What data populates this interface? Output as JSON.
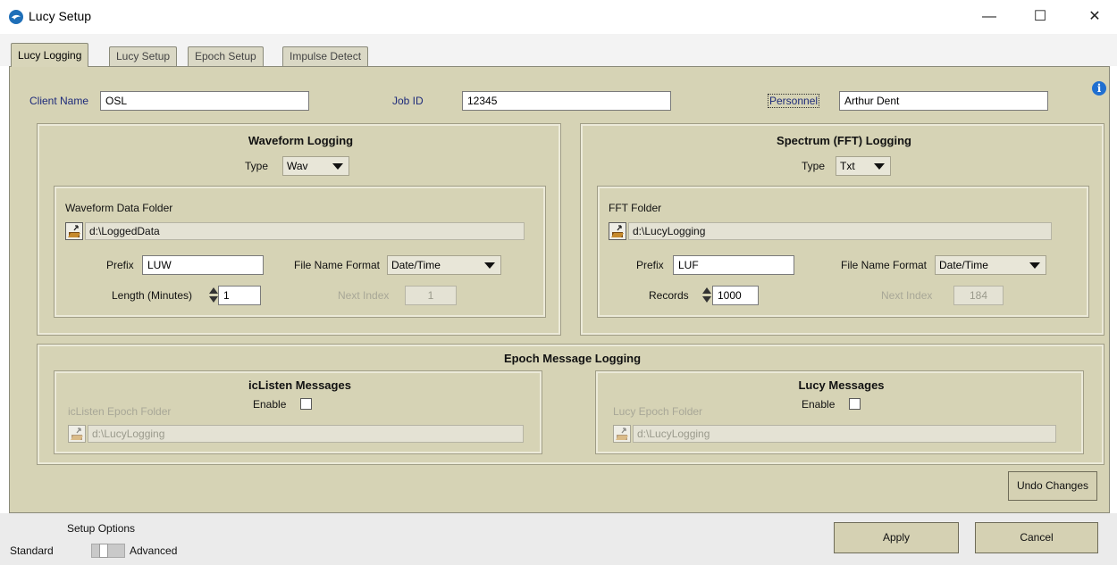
{
  "window": {
    "title": "Lucy Setup",
    "controls": {
      "minimize": "—",
      "maximize": "☐",
      "close": "✕"
    }
  },
  "tabs": [
    {
      "label": "Lucy Logging",
      "active": true
    },
    {
      "label": "Lucy Setup",
      "active": false
    },
    {
      "label": "Epoch Setup",
      "active": false
    },
    {
      "label": "Impulse Detect",
      "active": false
    }
  ],
  "header_fields": {
    "client_name": {
      "label": "Client Name",
      "value": "OSL"
    },
    "job_id": {
      "label": "Job ID",
      "value": "12345"
    },
    "personnel": {
      "label": "Personnel",
      "value": "Arthur Dent"
    }
  },
  "info_icon": "i",
  "waveform": {
    "title": "Waveform Logging",
    "type_label": "Type",
    "type_value": "Wav",
    "folder_label": "Waveform Data Folder",
    "folder_path": "d:\\LoggedData",
    "prefix_label": "Prefix",
    "prefix_value": "LUW",
    "format_label": "File Name Format",
    "format_value": "Date/Time",
    "length_label": "Length (Minutes)",
    "length_value": "1",
    "next_index_label": "Next Index",
    "next_index_value": "1"
  },
  "fft": {
    "title": "Spectrum (FFT) Logging",
    "type_label": "Type",
    "type_value": "Txt",
    "folder_label": "FFT Folder",
    "folder_path": "d:\\LucyLogging",
    "prefix_label": "Prefix",
    "prefix_value": "LUF",
    "format_label": "File Name Format",
    "format_value": "Date/Time",
    "records_label": "Records",
    "records_value": "1000",
    "next_index_label": "Next Index",
    "next_index_value": "184"
  },
  "epoch": {
    "title": "Epoch Message Logging",
    "iclisten": {
      "title": "icListen Messages",
      "enable_label": "Enable",
      "folder_label": "icListen Epoch Folder",
      "folder_path": "d:\\LucyLogging"
    },
    "lucy": {
      "title": "Lucy Messages",
      "enable_label": "Enable",
      "folder_label": "Lucy Epoch Folder",
      "folder_path": "d:\\LucyLogging"
    }
  },
  "undo_button": "Undo Changes",
  "setup_options": {
    "title": "Setup Options",
    "standard": "Standard",
    "advanced": "Advanced"
  },
  "apply_button": "Apply",
  "cancel_button": "Cancel",
  "colors": {
    "panel": "#d6d3b5",
    "label_blue": "#1e2b7a",
    "disabled_text": "#a8a797"
  }
}
